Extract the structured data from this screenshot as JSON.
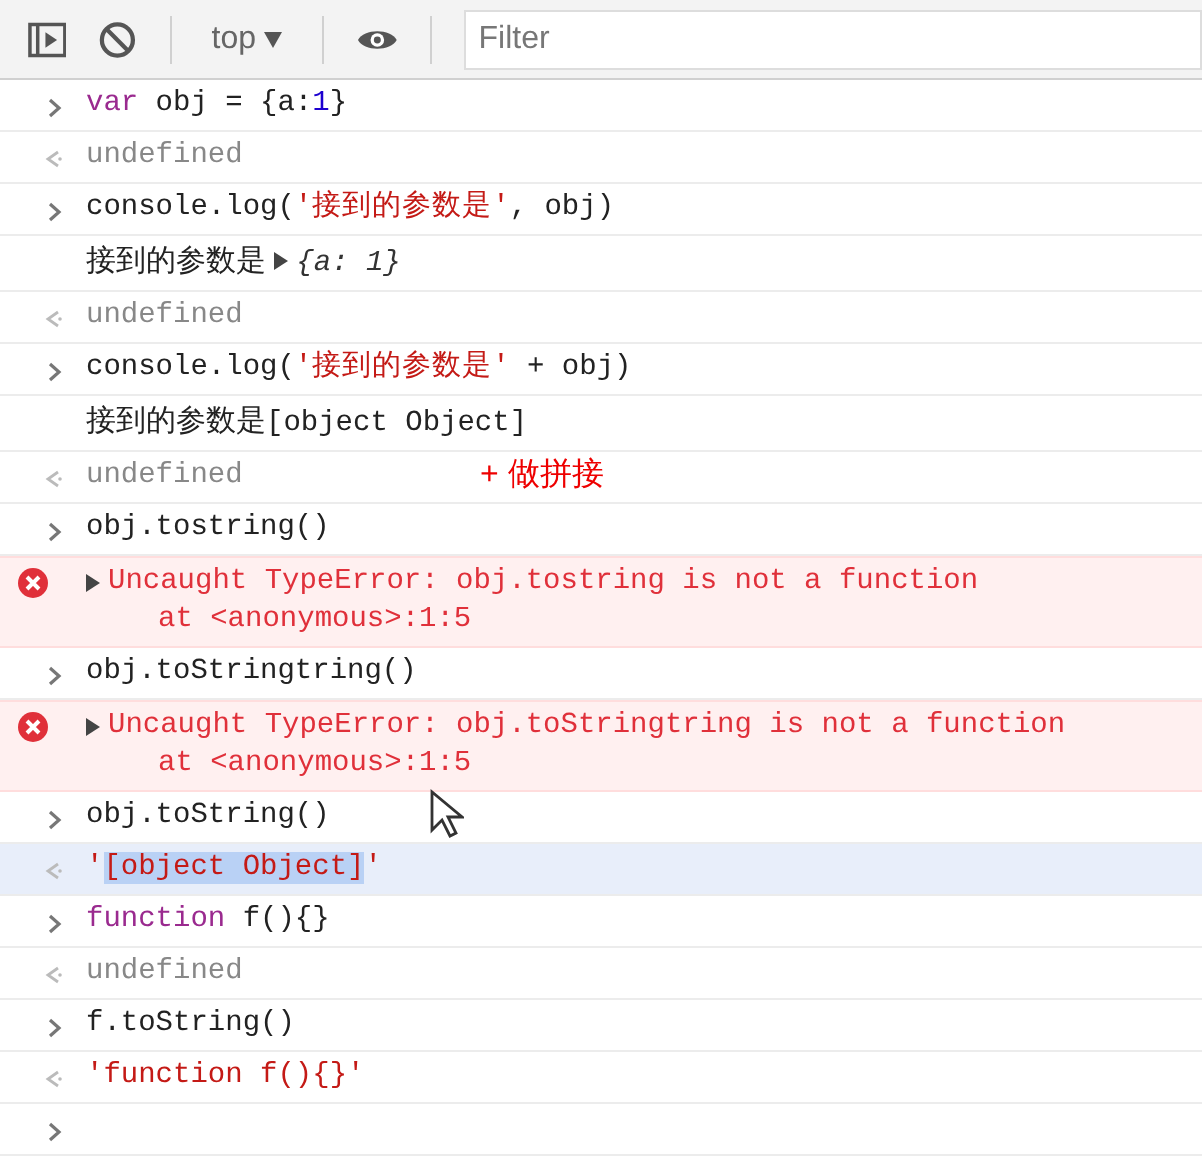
{
  "toolbar": {
    "context": "top",
    "filter_placeholder": "Filter"
  },
  "entries": [
    {
      "kind": "input",
      "selected": false,
      "parts": [
        {
          "kind": "keyword",
          "text": "var"
        },
        {
          "kind": "plain",
          "text": " obj = {a:"
        },
        {
          "kind": "number",
          "text": "1"
        },
        {
          "kind": "plain",
          "text": "}"
        }
      ]
    },
    {
      "kind": "result",
      "selected": false,
      "parts": [
        {
          "kind": "undefined",
          "text": "undefined"
        }
      ]
    },
    {
      "kind": "input",
      "selected": false,
      "parts": [
        {
          "kind": "plain",
          "text": "console.log("
        },
        {
          "kind": "string",
          "text": "'接到的参数是'"
        },
        {
          "kind": "plain",
          "text": ", obj)"
        }
      ]
    },
    {
      "kind": "log",
      "selected": false,
      "parts": [
        {
          "kind": "text",
          "text": "接到的参数是 "
        },
        {
          "kind": "object",
          "text": "{a: 1}"
        }
      ]
    },
    {
      "kind": "result",
      "selected": false,
      "parts": [
        {
          "kind": "undefined",
          "text": "undefined"
        }
      ]
    },
    {
      "kind": "input",
      "selected": false,
      "parts": [
        {
          "kind": "plain",
          "text": "console.log("
        },
        {
          "kind": "string",
          "text": "'接到的参数是'"
        },
        {
          "kind": "plain",
          "text": " + obj)"
        }
      ]
    },
    {
      "kind": "log",
      "selected": false,
      "parts": [
        {
          "kind": "text",
          "text": "接到的参数是"
        },
        {
          "kind": "plain",
          "text": "[object Object]"
        }
      ]
    },
    {
      "kind": "result",
      "selected": false,
      "annotation": "+ 做拼接",
      "parts": [
        {
          "kind": "undefined",
          "text": "undefined"
        }
      ]
    },
    {
      "kind": "input",
      "selected": false,
      "parts": [
        {
          "kind": "plain",
          "text": "obj.tostring()"
        }
      ]
    },
    {
      "kind": "error",
      "selected": false,
      "message": "Uncaught TypeError: obj.tostring is not a function",
      "location": "at <anonymous>:1:5"
    },
    {
      "kind": "input",
      "selected": false,
      "parts": [
        {
          "kind": "plain",
          "text": "obj.toStringtring()"
        }
      ]
    },
    {
      "kind": "error",
      "selected": false,
      "message": "Uncaught TypeError: obj.toStringtring is not a function",
      "location": "at <anonymous>:1:5"
    },
    {
      "kind": "input",
      "selected": false,
      "pointer": true,
      "parts": [
        {
          "kind": "plain",
          "text": "obj.toString()"
        }
      ]
    },
    {
      "kind": "result",
      "selected": true,
      "parts": [
        {
          "kind": "string",
          "text": "'"
        },
        {
          "kind": "string",
          "text": "[object Object]",
          "highlighted": true
        },
        {
          "kind": "string",
          "text": "'"
        }
      ]
    },
    {
      "kind": "input",
      "selected": false,
      "parts": [
        {
          "kind": "keyword",
          "text": "function"
        },
        {
          "kind": "plain",
          "text": " f(){}"
        }
      ]
    },
    {
      "kind": "result",
      "selected": false,
      "parts": [
        {
          "kind": "undefined",
          "text": "undefined"
        }
      ]
    },
    {
      "kind": "input",
      "selected": false,
      "parts": [
        {
          "kind": "plain",
          "text": "f.toString()"
        }
      ]
    },
    {
      "kind": "result",
      "selected": false,
      "parts": [
        {
          "kind": "string",
          "text": "'function f(){}'"
        }
      ]
    },
    {
      "kind": "prompt",
      "selected": false
    }
  ]
}
